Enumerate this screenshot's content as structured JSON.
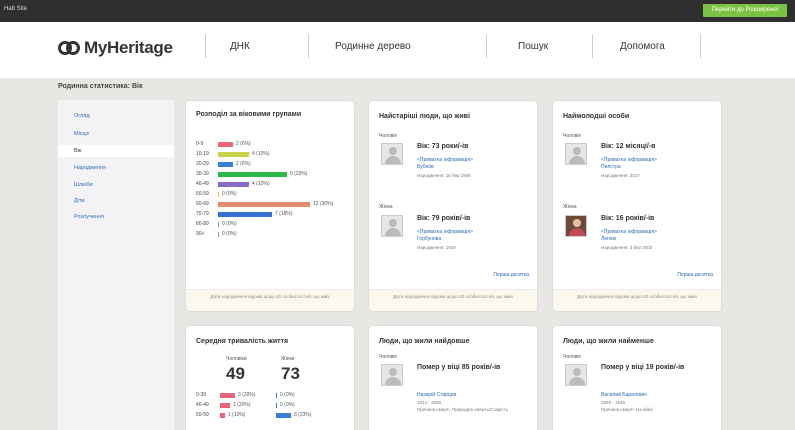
{
  "topbar": {
    "site_label": "Hab Site",
    "cta_label": "Перейти до Розширеної"
  },
  "brand": {
    "name": "MyHeritage"
  },
  "nav": {
    "items": [
      "ДНК",
      "Родинне дерево",
      "Пошук",
      "Допомога"
    ]
  },
  "page": {
    "title": "Родинна статистика: Вік"
  },
  "sidebar": {
    "items": [
      "Огляд",
      "Місця",
      "Вік",
      "Народження",
      "Шлюби",
      "Діти",
      "Розлучення"
    ]
  },
  "age_card": {
    "title": "Розподіл за віковими групами",
    "rows": [
      {
        "label": "0-9",
        "count": 2,
        "value": "2 (6%)",
        "color": "#e8657a"
      },
      {
        "label": "10-19",
        "count": 4,
        "value": "4 (10%)",
        "color": "#c9d449"
      },
      {
        "label": "20-29",
        "count": 2,
        "value": "2 (6%)",
        "color": "#3a7dd6"
      },
      {
        "label": "30-39",
        "count": 9,
        "value": "9 (23%)",
        "color": "#2db84a"
      },
      {
        "label": "40-49",
        "count": 4,
        "value": "4 (10%)",
        "color": "#8a6bc9"
      },
      {
        "label": "50-59",
        "count": 0,
        "value": "0 (0%)",
        "color": "#f2b33a"
      },
      {
        "label": "60-69",
        "count": 12,
        "value": "12 (30%)",
        "color": "#e58a6a"
      },
      {
        "label": "70-79",
        "count": 7,
        "value": "7 (18%)",
        "color": "#3a6fd6"
      },
      {
        "label": "80-89",
        "count": 0,
        "value": "0 (0%)",
        "color": "#999999"
      },
      {
        "label": "90+",
        "count": 0,
        "value": "0 (0%)",
        "color": "#999999"
      }
    ],
    "footer": "Дата народження відома щодо 40 особистостей, що живі"
  },
  "oldest_card": {
    "title": "Найстаріші люди, що живі",
    "male_label": "Чоловік",
    "male_age": "Вік: 73 роки/-ів",
    "male_name": "<Приватна інформація>",
    "male_surname": "Бубнов",
    "male_born": "Народження: 18 бер 1946",
    "female_label": "Жінка",
    "female_age": "Вік: 79 років/-ів",
    "female_name": "<Приватна інформація>",
    "female_surname": "Горбунова",
    "female_born": "Народження: 1939",
    "more_link": "Перша десятка",
    "footer": "Дата народження відома щодо 40 особистостей, що живі"
  },
  "youngest_card": {
    "title": "Наймолодші особи",
    "male_label": "Чоловік",
    "male_age": "Вік: 12 місяці/-в",
    "male_name": "<Приватна інформація>",
    "male_surname": "Пилстра",
    "male_born": "Народження: 2017",
    "female_label": "Жінка",
    "female_age": "Вік: 16 років/-ів",
    "female_name": "<Приватна інформація>",
    "female_surname": "Легких",
    "female_born": "Народження: 3 бер 2003",
    "more_link": "Перша десятка",
    "footer": "Дата народження відома щодо 40 особистостей, що живі"
  },
  "lifespan_card": {
    "title": "Середня тривалість життя",
    "male_label": "Чоловіки",
    "female_label": "Жінки",
    "male_value": "49",
    "female_value": "73",
    "rows": [
      {
        "label": "0-39",
        "male": "3 (20%)",
        "female": "0 (0%)",
        "male_count": 3,
        "female_count": 0
      },
      {
        "label": "40-49",
        "male": "2 (20%)",
        "female": "0 (0%)",
        "male_count": 2,
        "female_count": 0
      },
      {
        "label": "50-59",
        "male": "1 (10%)",
        "female": "3 (23%)",
        "male_count": 1,
        "female_count": 3
      }
    ]
  },
  "longest_card": {
    "title": "Люди, що жили найдовше",
    "male_label": "Чоловік",
    "age": "Помер у віці 85 років/-ів",
    "name": "Назарій Старцев",
    "dates": "1914 - 2000",
    "cause": "Причина смерті: Природна смерть/Старість"
  },
  "shortest_card": {
    "title": "Люди, що жили найменше",
    "male_label": "Чоловік",
    "age": "Помер у віці 19 років/-ів",
    "name": "Василий Баратевич",
    "dates": "1926 - 1946",
    "cause": "Причина смерті: На війні"
  }
}
